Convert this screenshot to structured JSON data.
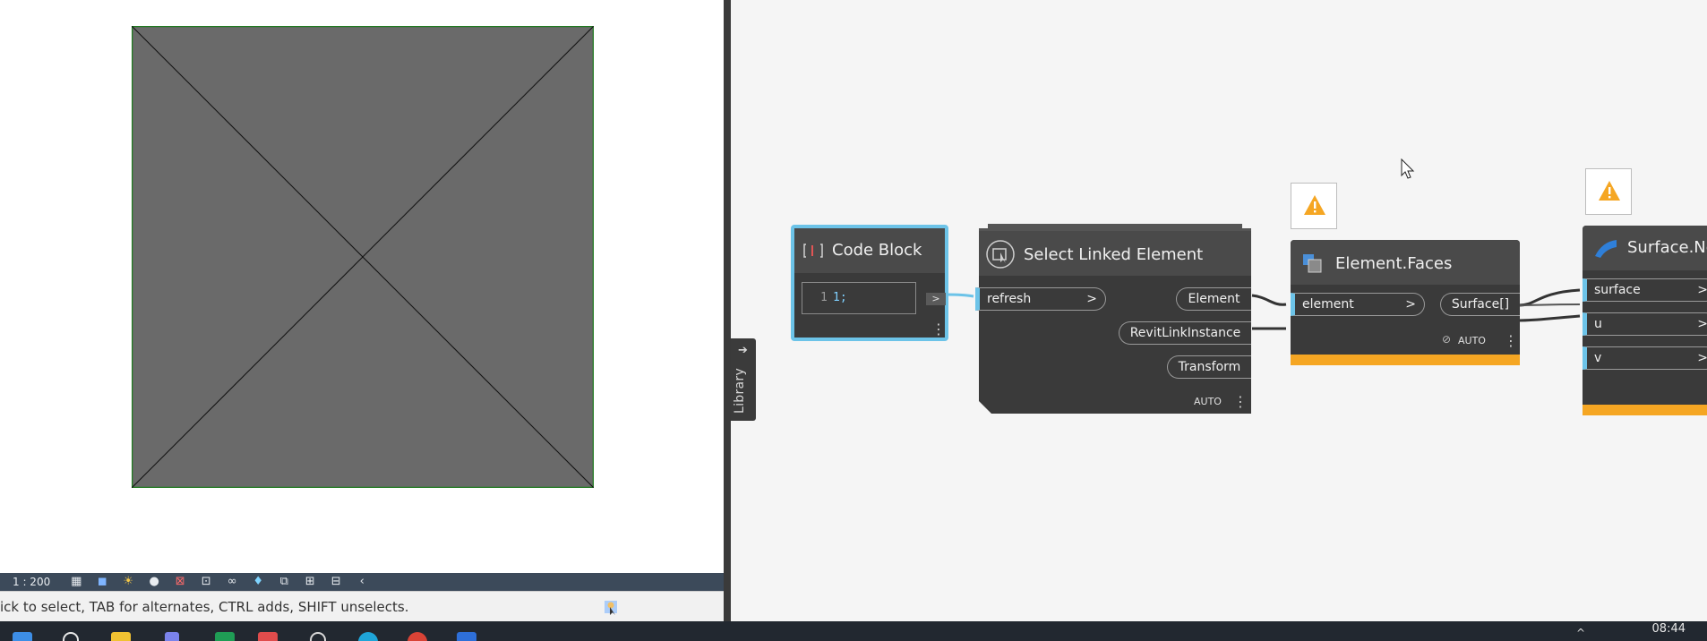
{
  "revit": {
    "scale": "1 : 200",
    "status_text": "ick to select, TAB for alternates, CTRL adds, SHIFT unselects.",
    "view_control_icons": [
      "detail-level-icon",
      "visual-style-icon",
      "sun-path-icon",
      "shadows-icon",
      "crop-view-icon",
      "show-crop-icon",
      "temporary-hide-icon",
      "reveal-hidden-icon",
      "worksharing-icon",
      "analytical-model-icon",
      "highlight-displacement-icon",
      "collapse-arrow-icon"
    ]
  },
  "dynamo": {
    "library_tab": "Library",
    "code_block": {
      "title": "Code Block",
      "line_number": "1",
      "code": "1;",
      "output_arrow": ">"
    },
    "select_linked": {
      "title": "Select Linked Element",
      "input": "refresh",
      "outputs": [
        "Element",
        "RevitLinkInstance",
        "Transform"
      ],
      "lacing": "AUTO"
    },
    "element_faces": {
      "title": "Element.Faces",
      "input": "element",
      "output": "Surface[]",
      "lacing": "AUTO"
    },
    "surface_node": {
      "title": "Surface.No",
      "inputs": [
        "surface",
        "u",
        "v"
      ]
    },
    "colors": {
      "warning": "#f5a623",
      "port_accent": "#6cc3e8",
      "selection": "#6cc3e8"
    }
  },
  "taskbar": {
    "clock": "08:44",
    "icons": [
      "start-icon",
      "search-icon",
      "file-explorer-icon",
      "teams-icon",
      "excel-icon",
      "calendar-icon",
      "settings-icon",
      "edge-icon",
      "chrome-icon",
      "dynamo-icon"
    ]
  }
}
